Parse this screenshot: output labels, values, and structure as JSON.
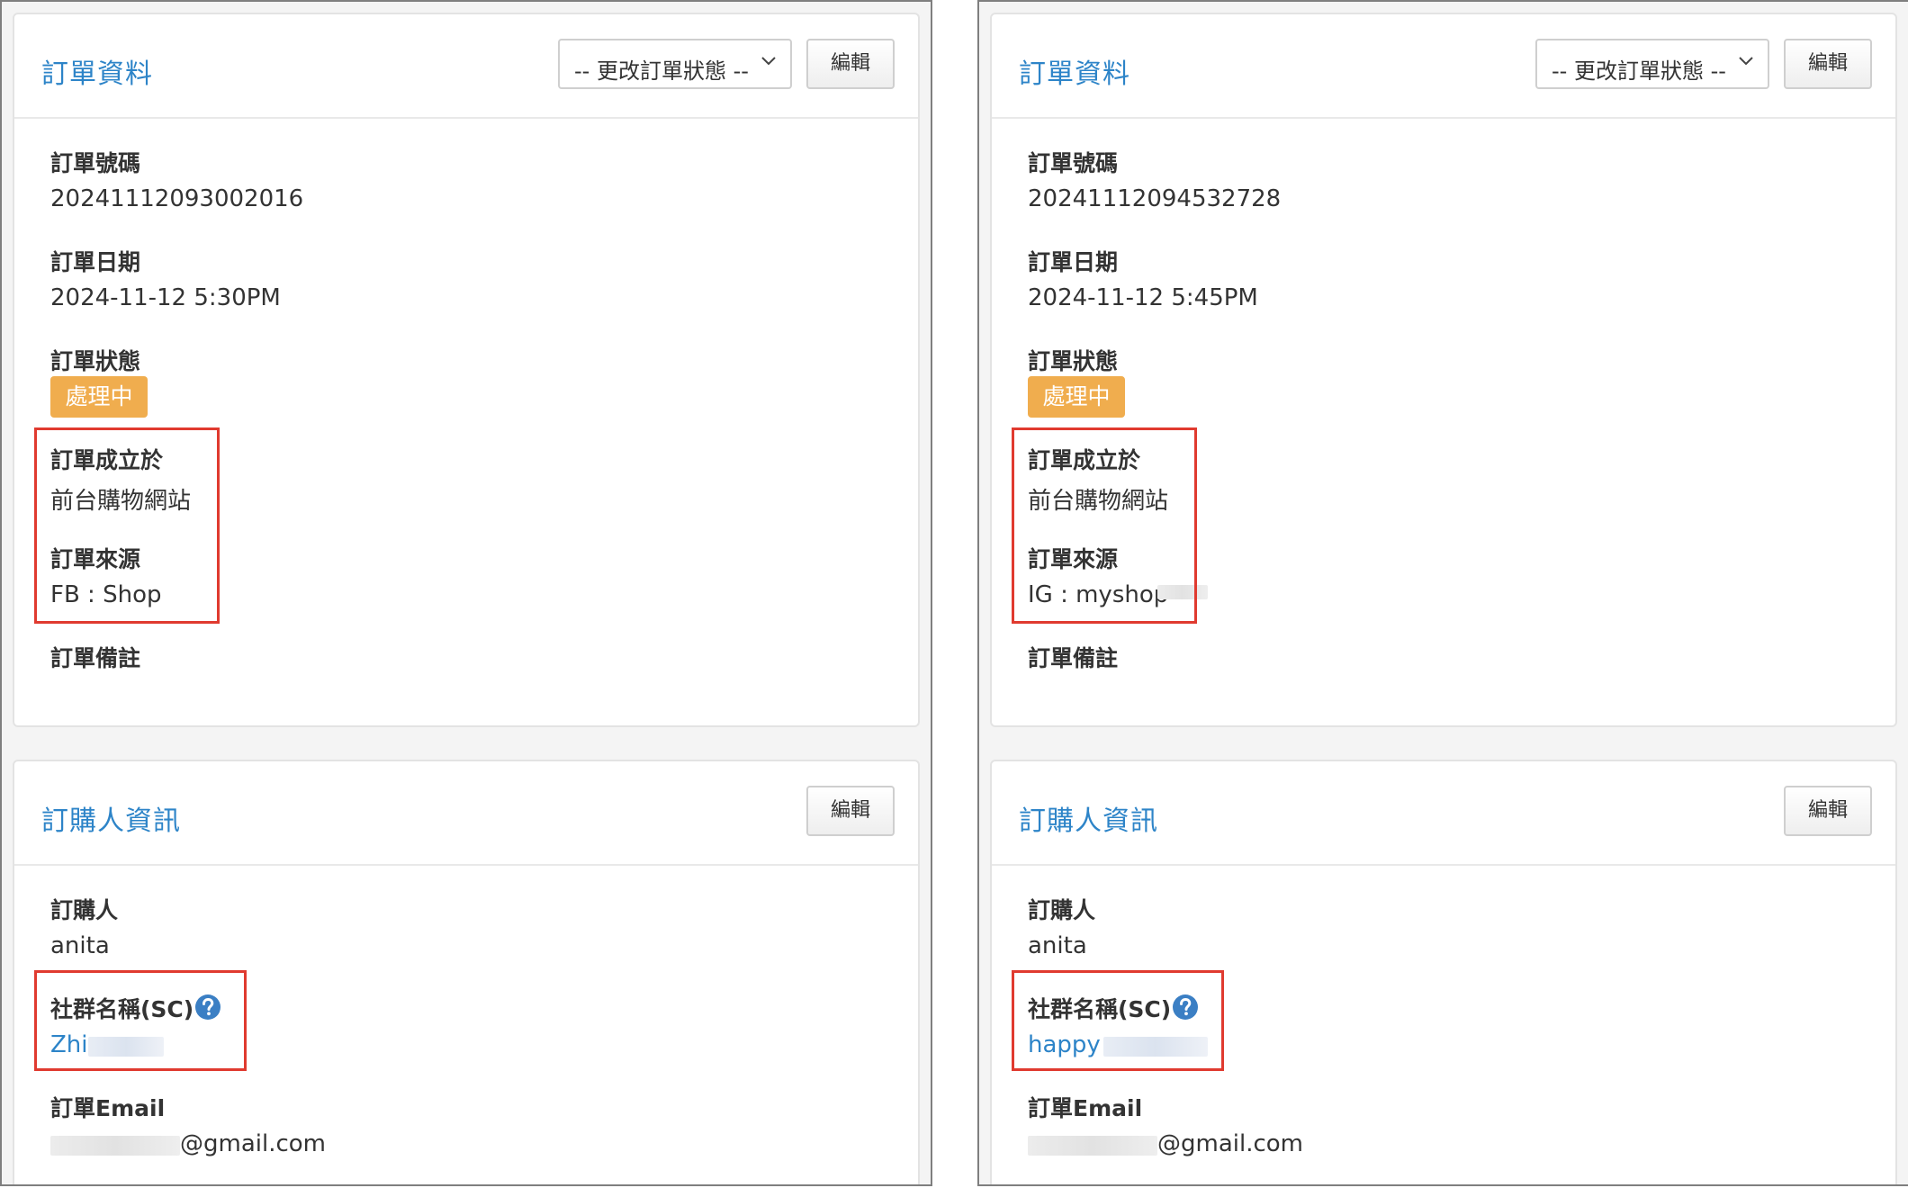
{
  "left": {
    "order": {
      "title": "訂單資料",
      "status_select": "-- 更改訂單狀態 --",
      "edit_label": "編輯",
      "order_no_label": "訂單號碼",
      "order_no": "20241112093002016",
      "date_label": "訂單日期",
      "date": "2024-11-12 5:30PM",
      "status_label": "訂單狀態",
      "status_badge": "處理中",
      "created_at_label": "訂單成立於",
      "created_at": "前台購物網站",
      "source_label": "訂單來源",
      "source": "FB : Shop",
      "note_label": "訂單備註"
    },
    "buyer": {
      "title": "訂購人資訊",
      "edit_label": "編輯",
      "name_label": "訂購人",
      "name": "anita",
      "social_label": "社群名稱(SC)",
      "social_name": "Zhi",
      "email_label": "訂單Email",
      "email_domain": "@gmail.com"
    }
  },
  "right": {
    "order": {
      "title": "訂單資料",
      "status_select": "-- 更改訂單狀態 --",
      "edit_label": "編輯",
      "order_no_label": "訂單號碼",
      "order_no": "20241112094532728",
      "date_label": "訂單日期",
      "date": "2024-11-12 5:45PM",
      "status_label": "訂單狀態",
      "status_badge": "處理中",
      "created_at_label": "訂單成立於",
      "created_at": "前台購物網站",
      "source_label": "訂單來源",
      "source": "IG : myshop",
      "note_label": "訂單備註"
    },
    "buyer": {
      "title": "訂購人資訊",
      "edit_label": "編輯",
      "name_label": "訂購人",
      "name": "anita",
      "social_label": "社群名稱(SC)",
      "social_name": "happy",
      "email_label": "訂單Email",
      "email_domain": "@gmail.com"
    }
  },
  "colors": {
    "title_blue": "#2d84c8",
    "badge_orange": "#f0ad4e",
    "highlight_red": "#e03a2f",
    "help_blue": "#3b7fc4"
  },
  "icons": {
    "help": "question-circle-icon",
    "dropdown": "chevron-down-icon"
  }
}
